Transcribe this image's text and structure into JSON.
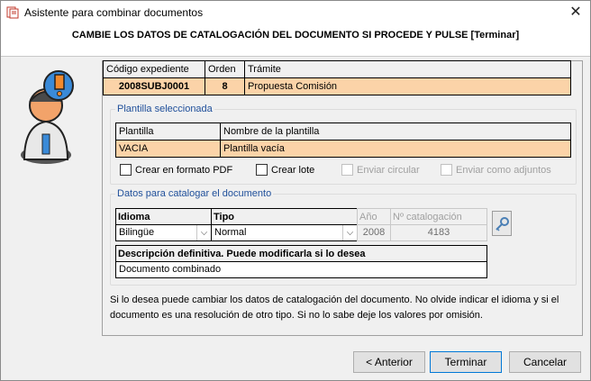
{
  "window": {
    "title": "Asistente para combinar documentos",
    "close_glyph": "✕",
    "heading": "CAMBIE LOS DATOS DE CATALOGACIÓN DEL DOCUMENTO SI PROCEDE Y PULSE [Terminar]"
  },
  "expediente": {
    "headers": {
      "codigo": "Código expediente",
      "orden": "Orden",
      "tramite": "Trámite"
    },
    "row": {
      "codigo": "2008SUBJ0001",
      "orden": "8",
      "tramite": "Propuesta Comisión"
    }
  },
  "plantilla": {
    "legend": "Plantilla seleccionada",
    "headers": {
      "plantilla": "Plantilla",
      "nombre": "Nombre de la plantilla"
    },
    "row": {
      "plantilla": "VACIA",
      "nombre": "Plantilla vacía"
    },
    "options": {
      "pdf": "Crear en formato PDF",
      "lote": "Crear lote",
      "circular": "Enviar circular",
      "adjuntos": "Enviar como adjuntos"
    }
  },
  "catalogo": {
    "legend": "Datos para catalogar el documento",
    "labels": {
      "idioma": "Idioma",
      "tipo": "Tipo",
      "anio": "Año",
      "num": "Nº catalogación"
    },
    "values": {
      "idioma": "Bilingüe",
      "tipo": "Normal",
      "anio": "2008",
      "num": "4183"
    },
    "desc_label": "Descripción definitiva. Puede modificarla si lo desea",
    "desc_value": "Documento combinado"
  },
  "info_text": "Si lo desea puede cambiar los datos de catalogación del documento. No olvide indicar el idioma y si el documento es una resolución de otro tipo. Si no lo sabe deje los valores por omisión.",
  "buttons": {
    "anterior": "< Anterior",
    "terminar": "Terminar",
    "cancelar": "Cancelar"
  },
  "icons": {
    "app": "document-merge-icon",
    "assistant": "assistant-figure-icon",
    "key": "key-icon",
    "dropdown": "chevron-down-icon"
  },
  "colors": {
    "highlight": "#fbd3a8",
    "legend": "#1f4f9a"
  }
}
